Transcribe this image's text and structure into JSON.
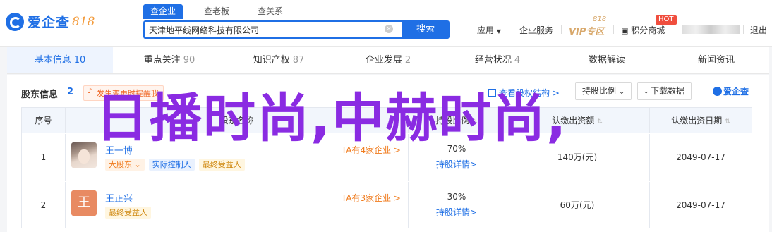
{
  "header": {
    "logo_text": "爱企查",
    "logo_num": "818",
    "search_tabs": [
      "查企业",
      "查老板",
      "查关系"
    ],
    "search_value": "天津地平线网络科技有限公司",
    "search_button": "搜索",
    "nav": {
      "apps": "应用",
      "enterprise_service": "企业服务",
      "vip_badge": "818",
      "vip_label": "VIP专区",
      "points_mall": "积分商城",
      "hot": "HOT",
      "logout": "退出"
    }
  },
  "tabs": [
    {
      "label": "基本信息",
      "count": "10"
    },
    {
      "label": "重点关注",
      "count": "90"
    },
    {
      "label": "知识产权",
      "count": "87"
    },
    {
      "label": "企业发展",
      "count": "2"
    },
    {
      "label": "经营状况",
      "count": "4"
    },
    {
      "label": "数据解读",
      "count": ""
    },
    {
      "label": "新闻资讯",
      "count": ""
    }
  ],
  "section": {
    "title": "股东信息",
    "count": "2",
    "alert": "发生变更时提醒我",
    "equity_link": "查看股权结构 >",
    "sort_button": "持股比例",
    "download_button": "下载数据",
    "mini_logo": "爱企查"
  },
  "table": {
    "headers": {
      "idx": "序号",
      "name": "股东名称",
      "ratio": "持股比例",
      "amount": "认缴出资额",
      "date": "认缴出资日期"
    },
    "rows": [
      {
        "idx": "1",
        "name": "王一博",
        "tags": [
          "大股东",
          "实际控制人",
          "最终受益人"
        ],
        "ta_link": "TA有4家企业 >",
        "ratio": "70%",
        "ratio_link": "持股详情>",
        "amount": "140万(元)",
        "date": "2049-07-17"
      },
      {
        "idx": "2",
        "name": "王正兴",
        "avatar_char": "王",
        "tags": [
          "最终受益人"
        ],
        "ta_link": "TA有3家企业 >",
        "ratio": "30%",
        "ratio_link": "持股详情>",
        "amount": "60万(元)",
        "date": "2049-07-17"
      }
    ]
  },
  "overlay_text": "日播时尚,中赫时尚,",
  "colors": {
    "brand": "#1f6fe5",
    "overlay": "#8a2be2",
    "accent_orange": "#f07b1d"
  }
}
